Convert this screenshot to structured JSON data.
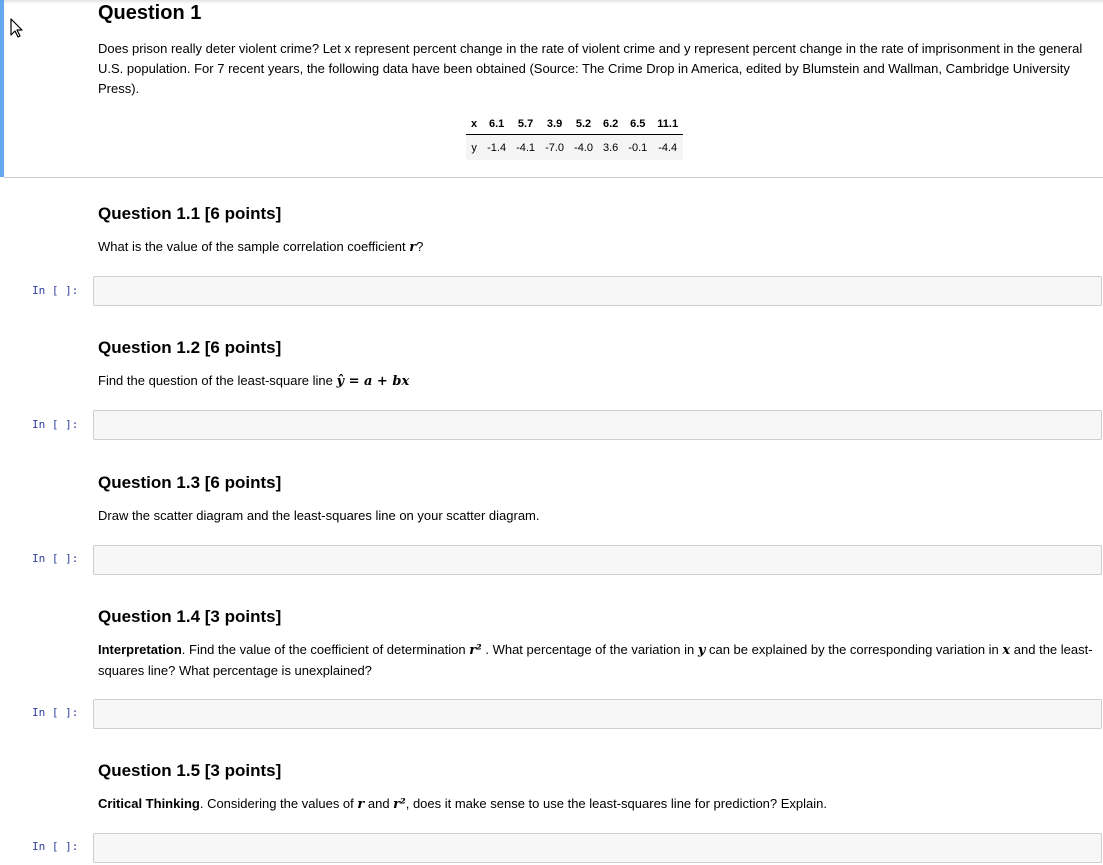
{
  "question1": {
    "title": "Question 1",
    "body": "Does prison really deter violent crime? Let x represent percent change in the rate of violent crime and y represent percent change in the rate of imprisonment in the general U.S. population. For 7 recent years, the following data have been obtained (Source: The Crime Drop in America, edited by Blumstein and Wallman, Cambridge University Press)."
  },
  "table": {
    "x_label": "x",
    "y_label": "y",
    "x": [
      "6.1",
      "5.7",
      "3.9",
      "5.2",
      "6.2",
      "6.5",
      "11.1"
    ],
    "y": [
      "-1.4",
      "-4.1",
      "-7.0",
      "-4.0",
      "3.6",
      "-0.1",
      "-4.4"
    ]
  },
  "q11": {
    "title": "Question 1.1 [6 points]",
    "text_before": "What is the value of the sample correlation coefficient ",
    "math_r": "r",
    "text_after": "?"
  },
  "q12": {
    "title": "Question 1.2 [6 points]",
    "text_before": "Find the question of the least-square line ",
    "math": "ŷ = a + bx"
  },
  "q13": {
    "title": "Question 1.3 [6 points]",
    "text": "Draw the scatter diagram and the least-squares line on your scatter diagram."
  },
  "q14": {
    "title": "Question 1.4 [3 points]",
    "bold_lead": "Interpretation",
    "text_1": ". Find the value of the coefficient of determination ",
    "math_r2": "r²",
    "text_2": " . What percentage of the variation in ",
    "math_y": "y",
    "text_3": " can be explained by the corresponding variation in ",
    "math_x": "x",
    "text_4": " and the least-squares line? What percentage is unexplained?"
  },
  "q15": {
    "title": "Question 1.5 [3 points]",
    "bold_lead": "Critical Thinking",
    "text_1": ". Considering the values of ",
    "math_r": "r",
    "text_2": " and ",
    "math_r2": "r²",
    "text_3": ", does it make sense to use the least-squares line for prediction? Explain."
  },
  "cells": {
    "prompt": "In [ ]:"
  },
  "colors": {
    "selection_bar": "#64a8ef",
    "prompt": "#303f9f",
    "code_bg": "#f7f7f7"
  }
}
